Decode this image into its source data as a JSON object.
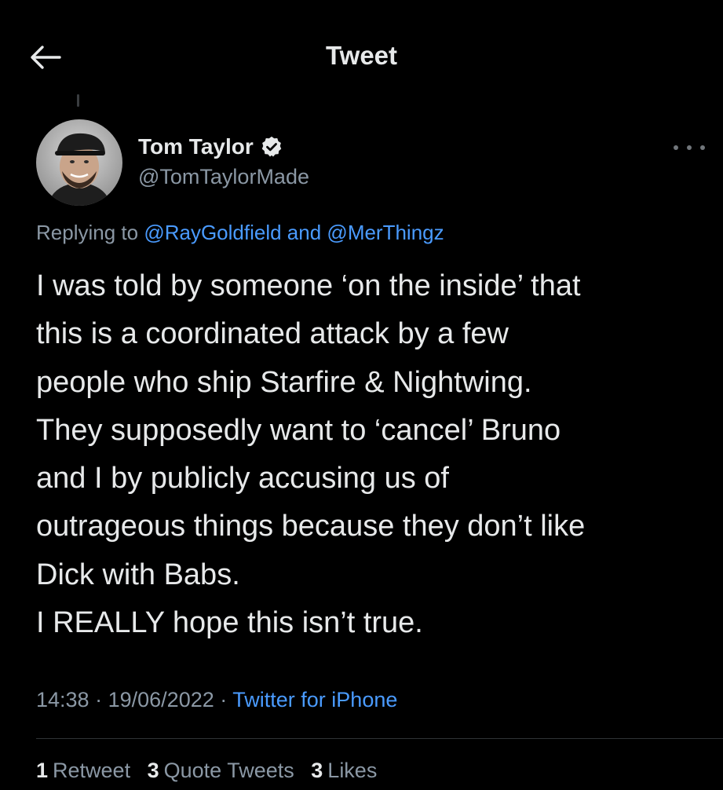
{
  "header": {
    "title": "Tweet",
    "back_icon": "arrow-left-icon"
  },
  "author": {
    "name": "Tom Taylor",
    "handle": "@TomTaylorMade",
    "verified_icon": "verified-badge-icon",
    "avatar_icon": "avatar-photo"
  },
  "more_icon": "more-dots-icon",
  "replying": {
    "prefix": "Replying to",
    "mention_1": "@RayGoldfield",
    "conjunction": "and",
    "mention_2": "@MerThingz"
  },
  "tweet": {
    "lines": [
      "I was told by someone ‘on the inside’ that",
      "this is a coordinated attack by a few",
      "people who ship Starfire & Nightwing.",
      "They supposedly want to ‘cancel’ Bruno",
      "and I by publicly accusing us of",
      "outrageous things because they don’t like",
      "Dick with Babs.",
      "I REALLY hope this isn’t true."
    ]
  },
  "meta": {
    "time": "14:38",
    "separator": "·",
    "date": "19/06/2022",
    "source": "Twitter for iPhone"
  },
  "stats": {
    "retweets_count": "1",
    "retweets_label": "Retweet",
    "quotes_count": "3",
    "quotes_label": "Quote Tweets",
    "likes_count": "3",
    "likes_label": "Likes"
  },
  "colors": {
    "background": "#000000",
    "text_primary": "#e7e9ea",
    "text_secondary": "#8b98a5",
    "link": "#4a9bff",
    "divider": "#2f3336"
  }
}
